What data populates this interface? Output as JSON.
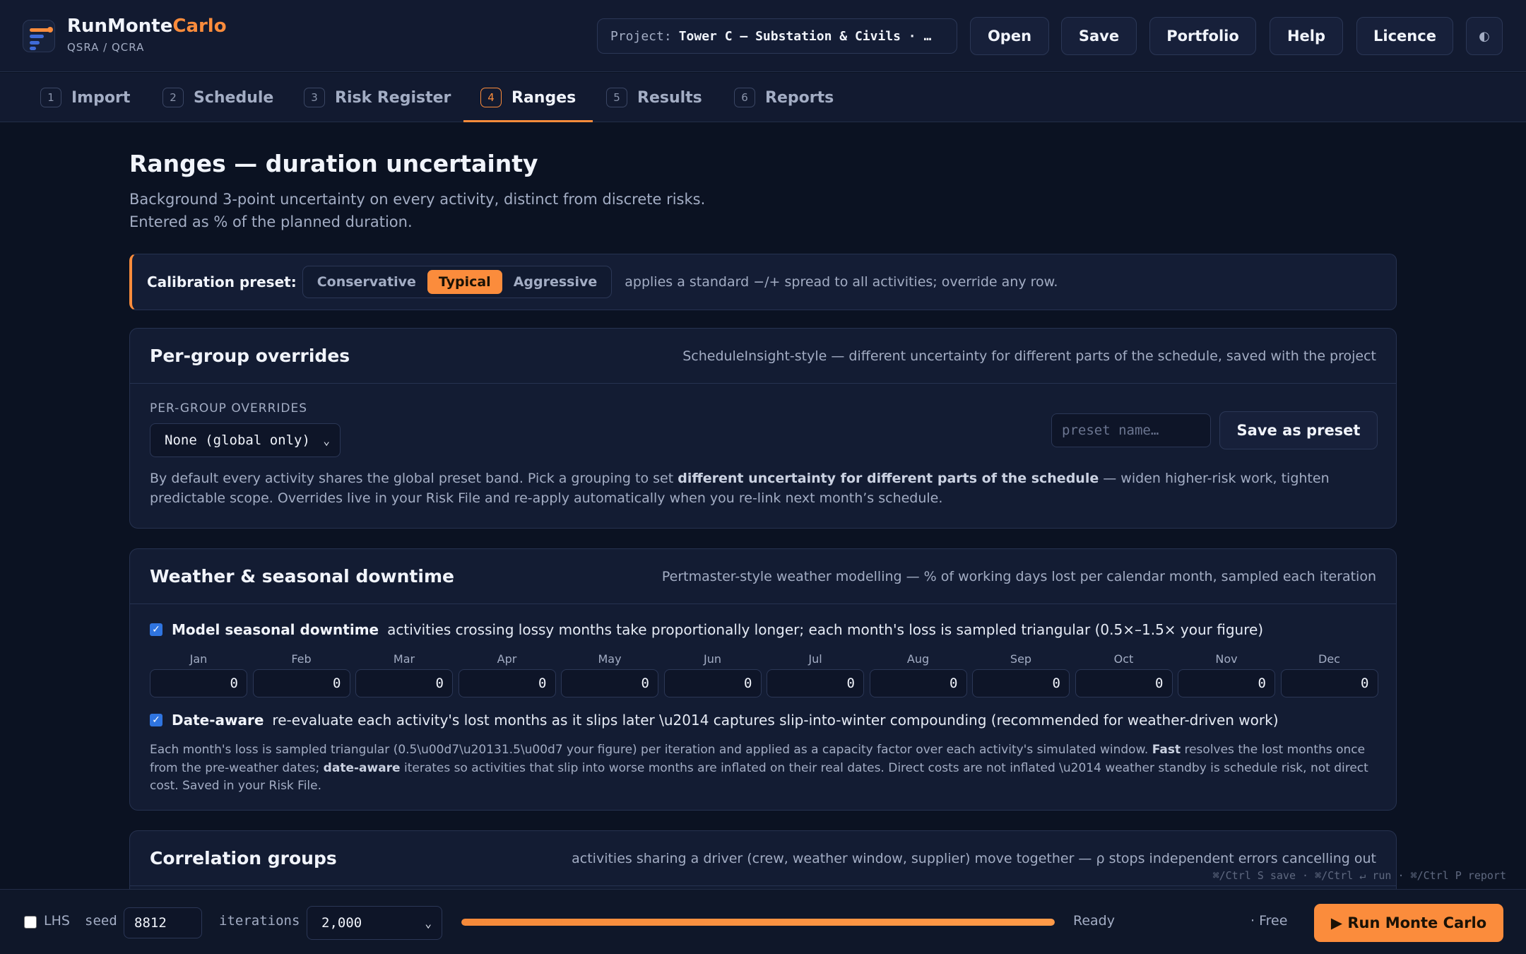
{
  "header": {
    "brand": {
      "name_main": "RunMonte",
      "name_accent": "Carlo",
      "subtitle": "QSRA / QCRA"
    },
    "project": {
      "label": "Project:",
      "value": "Tower C — Substation & Civils · …"
    },
    "buttons": {
      "open": "Open",
      "save": "Save",
      "portfolio": "Portfolio",
      "help": "Help",
      "licence": "Licence",
      "theme": "◐"
    },
    "brand_colors": {
      "accent": "#fb8c3c"
    }
  },
  "tabs": [
    {
      "num": "1",
      "label": "Import"
    },
    {
      "num": "2",
      "label": "Schedule"
    },
    {
      "num": "3",
      "label": "Risk Register"
    },
    {
      "num": "4",
      "label": "Ranges",
      "active": true
    },
    {
      "num": "5",
      "label": "Results"
    },
    {
      "num": "6",
      "label": "Reports"
    }
  ],
  "page": {
    "title": "Ranges — duration uncertainty",
    "desc_line1": "Background 3-point uncertainty on every activity, distinct from discrete risks.",
    "desc_line2": "Entered as % of the planned duration."
  },
  "calibration": {
    "label": "Calibration preset:",
    "options": [
      "Conservative",
      "Typical",
      "Aggressive"
    ],
    "selected": "Typical",
    "note": "applies a standard −/+ spread to all activities; override any row."
  },
  "per_group": {
    "title": "Per-group overrides",
    "subtitle": "ScheduleInsight-style — different uncertainty for different parts of the schedule, saved with the project",
    "field_label": "PER-GROUP OVERRIDES",
    "select_value": "None (global only)",
    "preset_placeholder": "preset name…",
    "save_preset": "Save as preset",
    "para_a": "By default every activity shares the global preset band. Pick a grouping to set ",
    "para_bold": "different uncertainty for different parts of the schedule",
    "para_b": " — widen higher-risk work, tighten",
    "para_line2": "predictable scope. Overrides live in your Risk File and re-apply automatically when you re-link next month’s schedule."
  },
  "weather": {
    "title": "Weather & seasonal downtime",
    "subtitle": "Pertmaster-style weather modelling — % of working days lost per calendar month, sampled each iteration",
    "model_checked": true,
    "model_label": "Model seasonal downtime",
    "model_desc": "activities crossing lossy months take proportionally longer; each month's loss is sampled triangular (0.5×–1.5× your figure)",
    "months": [
      {
        "name": "Jan",
        "value": "0"
      },
      {
        "name": "Feb",
        "value": "0"
      },
      {
        "name": "Mar",
        "value": "0"
      },
      {
        "name": "Apr",
        "value": "0"
      },
      {
        "name": "May",
        "value": "0"
      },
      {
        "name": "Jun",
        "value": "0"
      },
      {
        "name": "Jul",
        "value": "0"
      },
      {
        "name": "Aug",
        "value": "0"
      },
      {
        "name": "Sep",
        "value": "0"
      },
      {
        "name": "Oct",
        "value": "0"
      },
      {
        "name": "Nov",
        "value": "0"
      },
      {
        "name": "Dec",
        "value": "0"
      }
    ],
    "date_aware_checked": true,
    "date_aware_label": "Date-aware",
    "date_aware_desc": "re-evaluate each activity's lost months as it slips later \\u2014 captures slip-into-winter compounding (recommended for weather-driven work)",
    "foot_1": "Each month's loss is sampled triangular (0.5\\u00d7\\u20131.5\\u00d7 your figure) per iteration and applied as a capacity factor over each activity's simulated window. ",
    "foot_fast": "Fast",
    "foot_2": " resolves the lost months once",
    "foot_3": "from the pre-weather dates; ",
    "foot_da": "date-aware",
    "foot_4": " iterates so activities that slip into worse months are inflated on their real dates. Direct costs are not inflated \\u2014 weather standby is schedule risk, not direct",
    "foot_5": "cost. Saved in your Risk File."
  },
  "correlation": {
    "title": "Correlation groups",
    "subtitle": "activities sharing a driver (crew, weather window, supplier) move together — ρ stops independent errors cancelling out"
  },
  "footer": {
    "shortcuts": "⌘/Ctrl S save · ⌘/Ctrl ↵ run · ⌘/Ctrl P report",
    "lhs_label": "LHS",
    "lhs_checked": false,
    "seed_label": "seed",
    "seed_value": "8812",
    "iterations_label": "iterations",
    "iterations_value": "2,000",
    "progress_fraction": 1.0,
    "status": "Ready",
    "tier": "· Free",
    "run_label": "▶ Run Monte Carlo"
  }
}
